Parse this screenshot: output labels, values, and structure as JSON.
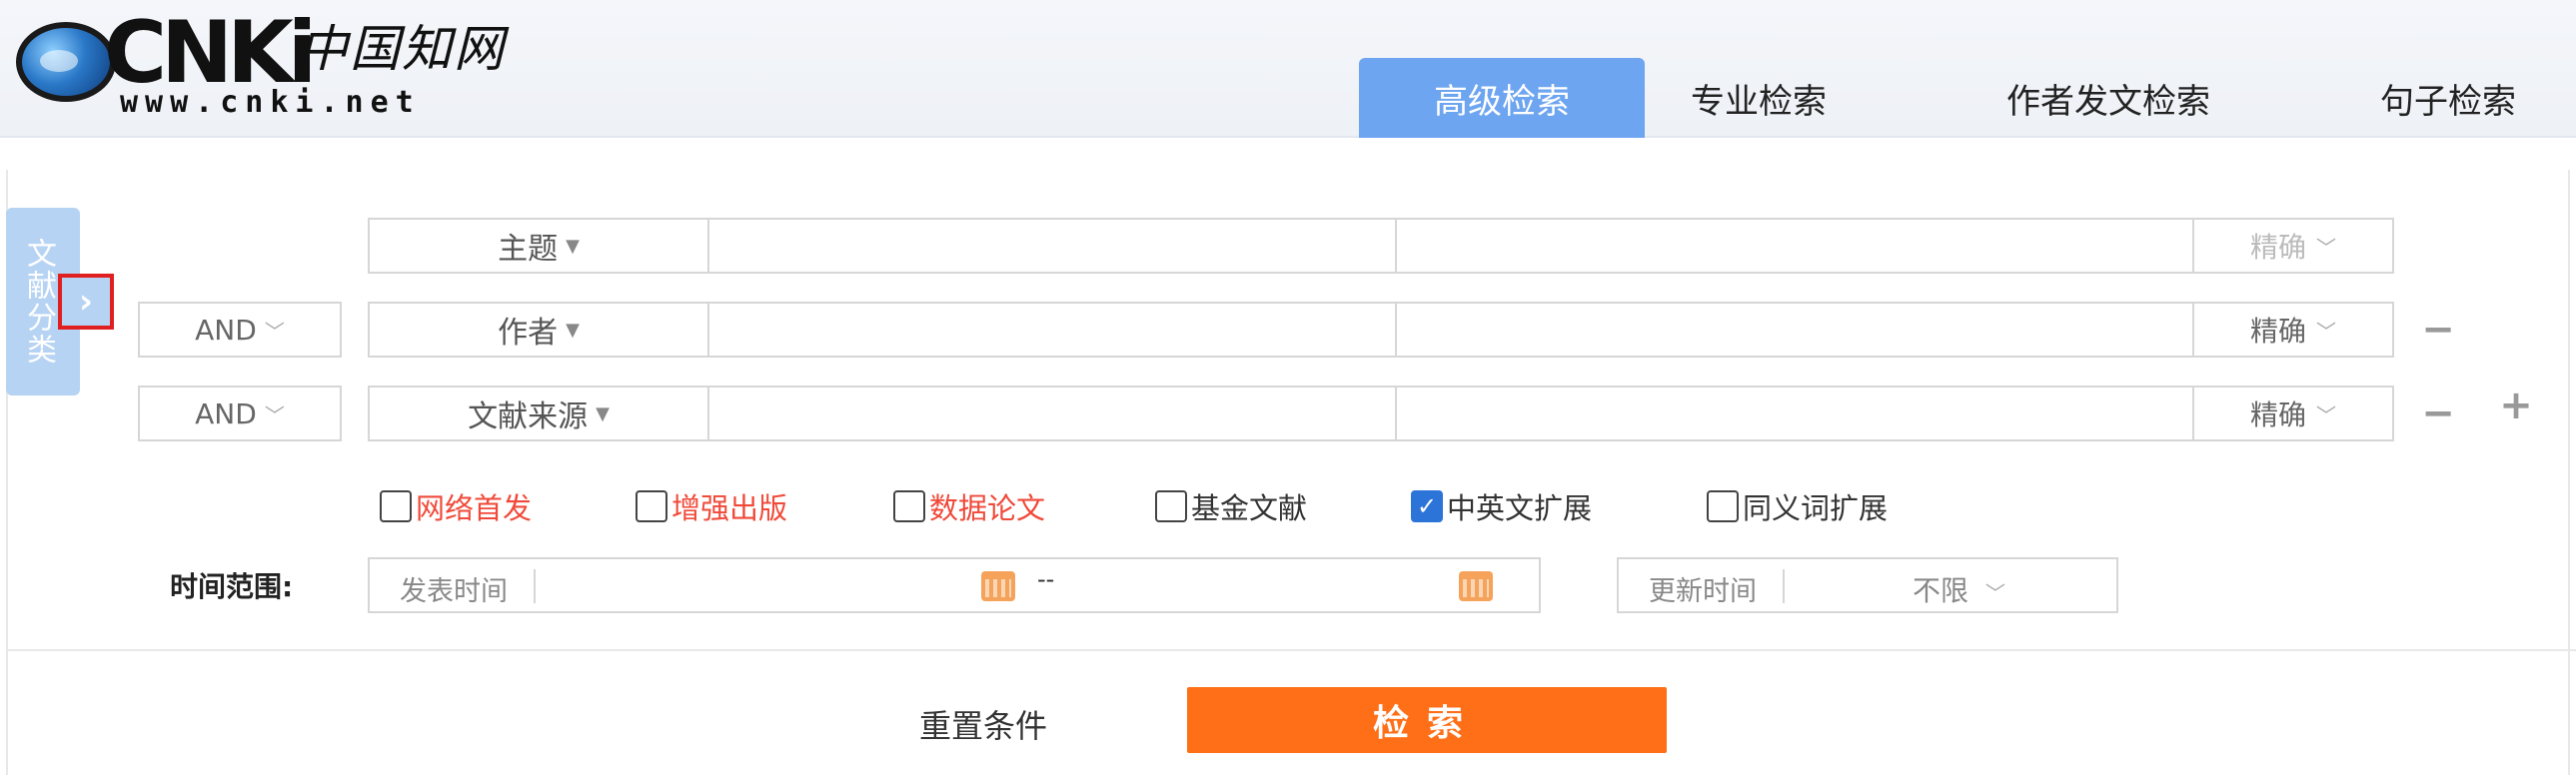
{
  "logo": {
    "brand": "CNKi",
    "cn_name": "中国知网",
    "url": "www.cnki.net"
  },
  "tabs": [
    {
      "label": "高级检索",
      "active": true
    },
    {
      "label": "专业检索",
      "active": false
    },
    {
      "label": "作者发文检索",
      "active": false
    },
    {
      "label": "句子检索",
      "active": false
    }
  ],
  "side_panel": {
    "label": "文献分类",
    "expand_glyph": "›"
  },
  "rows": [
    {
      "logic": "",
      "field": "主题",
      "match": "精确",
      "match_muted": true
    },
    {
      "logic": "AND",
      "field": "作者",
      "match": "精确",
      "match_muted": false
    },
    {
      "logic": "AND",
      "field": "文献来源",
      "match": "精确",
      "match_muted": false
    }
  ],
  "checkboxes": [
    {
      "label": "网络首发",
      "checked": false,
      "color": "#f04a3a"
    },
    {
      "label": "增强出版",
      "checked": false,
      "color": "#f04a3a"
    },
    {
      "label": "数据论文",
      "checked": false,
      "color": "#f04a3a"
    },
    {
      "label": "基金文献",
      "checked": false,
      "color": "#333333"
    },
    {
      "label": "中英文扩展",
      "checked": true,
      "color": "#333333"
    },
    {
      "label": "同义词扩展",
      "checked": false,
      "color": "#333333"
    }
  ],
  "time": {
    "label": "时间范围:",
    "publish_label": "发表时间",
    "range_sep": "--",
    "update_label": "更新时间",
    "update_value": "不限"
  },
  "actions": {
    "reset": "重置条件",
    "search": "检索"
  },
  "colors": {
    "accent_tab": "#6ea5f0",
    "search_btn": "#ff6f17",
    "side_panel": "#b7d3f3",
    "highlight_red": "#e02020"
  }
}
